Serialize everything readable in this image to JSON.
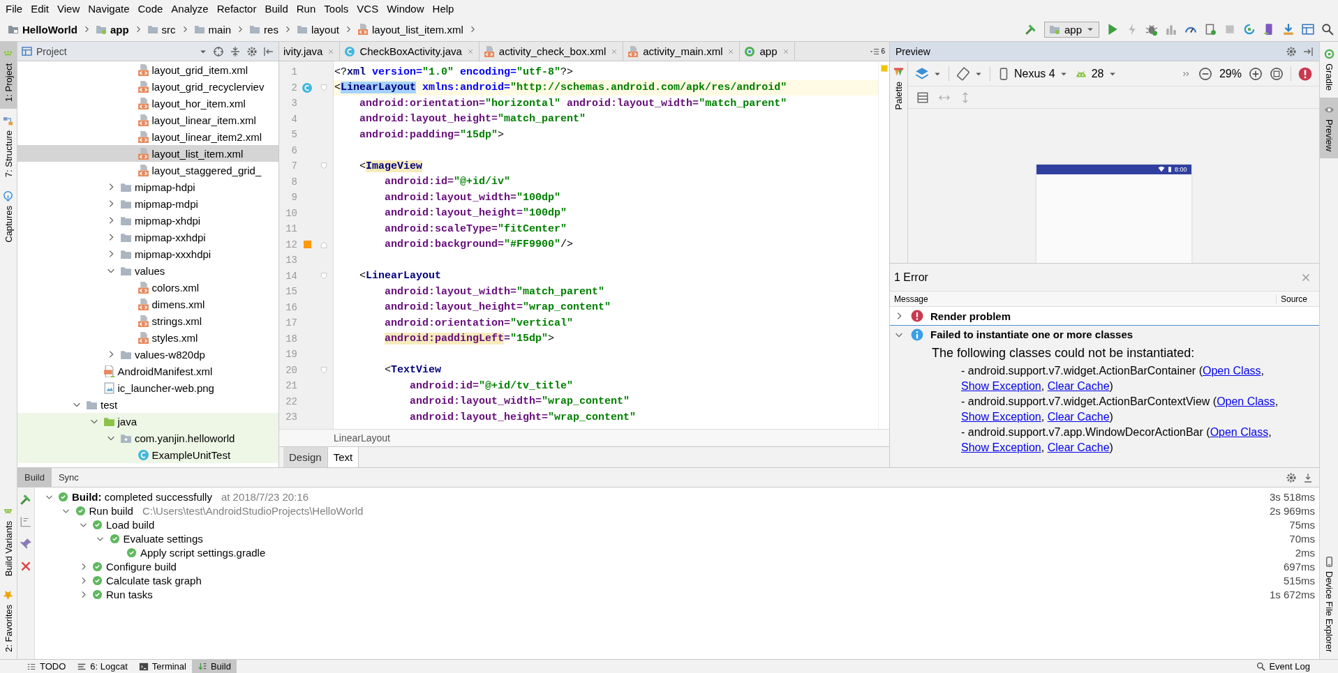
{
  "menu": [
    "File",
    "Edit",
    "View",
    "Navigate",
    "Code",
    "Analyze",
    "Refactor",
    "Build",
    "Run",
    "Tools",
    "VCS",
    "Window",
    "Help"
  ],
  "navbar": {
    "breadcrumbs": [
      {
        "label": "HelloWorld",
        "kind": "project"
      },
      {
        "label": "app",
        "kind": "module"
      },
      {
        "label": "src",
        "kind": "folder"
      },
      {
        "label": "main",
        "kind": "folder"
      },
      {
        "label": "res",
        "kind": "folder"
      },
      {
        "label": "layout",
        "kind": "folder"
      },
      {
        "label": "layout_list_item.xml",
        "kind": "xml"
      }
    ],
    "run_config": "app"
  },
  "tool_strips": {
    "left_top": [
      {
        "label": "1: Project",
        "kind": "android",
        "selected": true
      },
      {
        "label": "7: Structure",
        "kind": "structure",
        "selected": false
      },
      {
        "label": "Captures",
        "kind": "captures",
        "selected": false
      }
    ],
    "left_bottom": [
      {
        "label": "Build Variants",
        "kind": "android",
        "selected": false
      },
      {
        "label": "2: Favorites",
        "kind": "star",
        "selected": false
      }
    ],
    "right_top": [
      {
        "label": "Gradle",
        "kind": "gradle",
        "selected": false
      },
      {
        "label": "Preview",
        "kind": "eye",
        "selected": true
      }
    ],
    "right_bottom": [
      {
        "label": "Device File Explorer",
        "kind": "device",
        "selected": false
      }
    ]
  },
  "project_panel": {
    "title": "Project",
    "tree": [
      {
        "children": [
          {
            "children": [
              {
                "children": [
                  {
                    "label": "layout_grid_item.xml",
                    "kind": "xml",
                    "selected": false
                  },
                  {
                    "label": "layout_grid_recyclerviev",
                    "kind": "xml",
                    "selected": false
                  },
                  {
                    "label": "layout_hor_item.xml",
                    "kind": "xml",
                    "selected": false
                  },
                  {
                    "label": "layout_linear_item.xml",
                    "kind": "xml",
                    "selected": false
                  },
                  {
                    "label": "layout_linear_item2.xml",
                    "kind": "xml",
                    "selected": false
                  },
                  {
                    "label": "layout_list_item.xml",
                    "kind": "xml",
                    "selected": true
                  },
                  {
                    "label": "layout_staggered_grid_",
                    "kind": "xml",
                    "selected": false
                  }
                ]
              },
              {
                "label": "mipmap-hdpi",
                "kind": "folder",
                "selected": false,
                "expanded": false
              },
              {
                "label": "mipmap-mdpi",
                "kind": "folder",
                "selected": false,
                "expanded": false
              },
              {
                "label": "mipmap-xhdpi",
                "kind": "folder",
                "selected": false,
                "expanded": false
              },
              {
                "label": "mipmap-xxhdpi",
                "kind": "folder",
                "selected": false,
                "expanded": false
              },
              {
                "label": "mipmap-xxxhdpi",
                "kind": "folder",
                "selected": false,
                "expanded": false
              },
              {
                "label": "values",
                "kind": "folder",
                "selected": false,
                "expanded": true,
                "children": [
                  {
                    "label": "colors.xml",
                    "kind": "xml",
                    "selected": false
                  },
                  {
                    "label": "dimens.xml",
                    "kind": "xml",
                    "selected": false
                  },
                  {
                    "label": "strings.xml",
                    "kind": "xml",
                    "selected": false
                  },
                  {
                    "label": "styles.xml",
                    "kind": "xml",
                    "selected": false
                  }
                ]
              },
              {
                "label": "values-w820dp",
                "kind": "folder",
                "selected": false,
                "expanded": false
              }
            ]
          },
          {
            "label": "AndroidManifest.xml",
            "kind": "manifest",
            "selected": false
          },
          {
            "label": "ic_launcher-web.png",
            "kind": "image",
            "selected": false
          }
        ]
      },
      {
        "label": "test",
        "kind": "folder",
        "selected": false,
        "expanded": true,
        "children": [
          {
            "label": "java",
            "kind": "test-root",
            "selected": false,
            "expanded": true,
            "children": [
              {
                "label": "com.yanjin.helloworld",
                "kind": "package",
                "selected": false,
                "expanded": true,
                "children": [
                  {
                    "label": "ExampleUnitTest",
                    "kind": "class",
                    "selected": false
                  }
                ]
              }
            ]
          }
        ]
      }
    ]
  },
  "editor": {
    "tabs": [
      {
        "label": "ivity.java",
        "kind": "cut",
        "selected": false
      },
      {
        "label": "CheckBoxActivity.java",
        "kind": "class",
        "selected": false
      },
      {
        "label": "activity_check_box.xml",
        "kind": "xml",
        "selected": false
      },
      {
        "label": "activity_main.xml",
        "kind": "xml",
        "selected": false
      },
      {
        "label": "app",
        "kind": "run",
        "selected": false
      }
    ],
    "hidden_tab_count": "6",
    "lines": [
      {
        "number": "1",
        "current": false,
        "tokens": [
          {
            "kind": "punct",
            "text": "<?"
          },
          {
            "kind": "tag",
            "text": "xml"
          },
          {
            "kind": "ns",
            "text": " version="
          },
          {
            "kind": "value",
            "text": "\"1.0\""
          },
          {
            "kind": "ns",
            "text": " encoding="
          },
          {
            "kind": "value",
            "text": "\"utf-8\""
          },
          {
            "kind": "punct",
            "text": "?>"
          }
        ]
      },
      {
        "number": "2",
        "current": true,
        "class_marker": true,
        "fold_start": true,
        "tokens": [
          {
            "kind": "punct",
            "text": "<"
          },
          {
            "kind": "tag",
            "text": "LinearLayout",
            "selected": true
          },
          {
            "kind": "ns",
            "text": " xmlns:android="
          },
          {
            "kind": "value",
            "text": "\"http://schemas.android.com/apk/res/android\""
          }
        ]
      },
      {
        "number": "3",
        "current": false,
        "tokens": [
          {
            "kind": "attr",
            "text": "    android:orientation="
          },
          {
            "kind": "value",
            "text": "\"horizontal\""
          },
          {
            "kind": "attr",
            "text": " android:layout_width="
          },
          {
            "kind": "value",
            "text": "\"match_parent\""
          }
        ]
      },
      {
        "number": "4",
        "current": false,
        "tokens": [
          {
            "kind": "attr",
            "text": "    android:layout_height="
          },
          {
            "kind": "value",
            "text": "\"match_parent\""
          }
        ]
      },
      {
        "number": "5",
        "current": false,
        "tokens": [
          {
            "kind": "attr",
            "text": "    android:padding="
          },
          {
            "kind": "value",
            "text": "\"15dp\""
          },
          {
            "kind": "punct",
            "text": ">"
          }
        ]
      },
      {
        "number": "6",
        "current": false
      },
      {
        "number": "7",
        "current": false,
        "fold_start": true,
        "tokens": [
          {
            "kind": "punct",
            "text": "    <"
          },
          {
            "kind": "tag",
            "text": "ImageView",
            "matched": true
          }
        ]
      },
      {
        "number": "8",
        "current": false,
        "tokens": [
          {
            "kind": "attr",
            "text": "        android:id="
          },
          {
            "kind": "value",
            "text": "\"@+id/iv\""
          }
        ]
      },
      {
        "number": "9",
        "current": false,
        "tokens": [
          {
            "kind": "attr",
            "text": "        android:layout_width="
          },
          {
            "kind": "value",
            "text": "\"100dp\""
          }
        ]
      },
      {
        "number": "10",
        "current": false,
        "tokens": [
          {
            "kind": "attr",
            "text": "        android:layout_height="
          },
          {
            "kind": "value",
            "text": "\"100dp\""
          }
        ]
      },
      {
        "number": "11",
        "current": false,
        "tokens": [
          {
            "kind": "attr",
            "text": "        android:scaleType="
          },
          {
            "kind": "value",
            "text": "\"fitCenter\""
          }
        ]
      },
      {
        "number": "12",
        "current": false,
        "color": "#ff9900",
        "fold_end": true,
        "tokens": [
          {
            "kind": "attr",
            "text": "        android:background="
          },
          {
            "kind": "value",
            "text": "\"#FF9900\""
          },
          {
            "kind": "punct",
            "text": "/>"
          }
        ]
      },
      {
        "number": "13",
        "current": false
      },
      {
        "number": "14",
        "current": false,
        "fold_start": true,
        "tokens": [
          {
            "kind": "punct",
            "text": "    <"
          },
          {
            "kind": "tag",
            "text": "LinearLayout"
          }
        ]
      },
      {
        "number": "15",
        "current": false,
        "tokens": [
          {
            "kind": "attr",
            "text": "        android:layout_width="
          },
          {
            "kind": "value",
            "text": "\"match_parent\""
          }
        ]
      },
      {
        "number": "16",
        "current": false,
        "tokens": [
          {
            "kind": "attr",
            "text": "        android:layout_height="
          },
          {
            "kind": "value",
            "text": "\"wrap_content\""
          }
        ]
      },
      {
        "number": "17",
        "current": false,
        "tokens": [
          {
            "kind": "attr",
            "text": "        android:orientation="
          },
          {
            "kind": "value",
            "text": "\"vertical\""
          }
        ]
      },
      {
        "number": "18",
        "current": false,
        "tokens": [
          {
            "kind": "attr",
            "text": "        android:paddingLeft",
            "matched": true
          },
          {
            "kind": "attr",
            "text": "="
          },
          {
            "kind": "value",
            "text": "\"15dp\""
          },
          {
            "kind": "punct",
            "text": ">"
          }
        ]
      },
      {
        "number": "19",
        "current": false
      },
      {
        "number": "20",
        "current": false,
        "fold_start": true,
        "tokens": [
          {
            "kind": "punct",
            "text": "        <"
          },
          {
            "kind": "tag",
            "text": "TextView"
          }
        ]
      },
      {
        "number": "21",
        "current": false,
        "tokens": [
          {
            "kind": "attr",
            "text": "            android:id="
          },
          {
            "kind": "value",
            "text": "\"@+id/tv_title\""
          }
        ]
      },
      {
        "number": "22",
        "current": false,
        "tokens": [
          {
            "kind": "attr",
            "text": "            android:layout_width="
          },
          {
            "kind": "value",
            "text": "\"wrap_content\""
          }
        ]
      },
      {
        "number": "23",
        "current": false,
        "tokens": [
          {
            "kind": "attr",
            "text": "            android:layout_height="
          },
          {
            "kind": "value",
            "text": "\"wrap_content\""
          }
        ]
      }
    ],
    "breadcrumb": "LinearLayout",
    "mode_tabs": [
      {
        "label": "Design",
        "selected": false
      },
      {
        "label": "Text",
        "selected": true
      }
    ]
  },
  "preview": {
    "title": "Preview",
    "palette_label": "Palette",
    "device": "Nexus 4",
    "api_level": "28",
    "zoom": "29%",
    "status_time": "8:00",
    "errors": {
      "title": "1 Error",
      "columns": [
        "Message",
        "Source"
      ],
      "items": [
        {
          "kind": "error",
          "title": "Render problem",
          "expanded": false,
          "selected": false
        },
        {
          "kind": "info",
          "title": "Failed to instantiate one or more classes",
          "expanded": true,
          "selected": true,
          "intro": "The following classes could not be instantiated:",
          "entries": [
            [
              {
                "text": "- android.support.v7.widget.ActionBarContainer ("
              },
              {
                "link": "Open Class"
              },
              {
                "text": ", "
              },
              {
                "link": "Show Exception"
              },
              {
                "text": ", "
              },
              {
                "link": "Clear Cache"
              },
              {
                "text": ")"
              }
            ],
            [
              {
                "text": "- android.support.v7.widget.ActionBarContextView ("
              },
              {
                "link": "Open Class"
              },
              {
                "text": ", "
              },
              {
                "link": "Show Exception"
              },
              {
                "text": ", "
              },
              {
                "link": "Clear Cache"
              },
              {
                "text": ")"
              }
            ],
            [
              {
                "text": "- android.support.v7.app.WindowDecorActionBar ("
              },
              {
                "link": "Open Class"
              },
              {
                "text": ", "
              },
              {
                "link": "Show Exception"
              },
              {
                "text": ", "
              },
              {
                "link": "Clear Cache"
              },
              {
                "text": ")"
              }
            ]
          ]
        }
      ]
    }
  },
  "build": {
    "tabs": [
      {
        "label": "Build",
        "selected": true
      },
      {
        "label": "Sync",
        "selected": false
      }
    ],
    "tree": [
      {
        "label": "**Build:** completed successfully",
        "note": "at 2018/7/23 20:16",
        "duration": "3s 518ms",
        "succeeded": true,
        "expanded": true,
        "children": [
          {
            "label": "Run build",
            "note": "C:\\Users\\test\\AndroidStudioProjects\\HelloWorld",
            "duration": "2s 969ms",
            "succeeded": true,
            "expanded": true,
            "children": [
              {
                "label": "Load build",
                "duration": "75ms",
                "succeeded": true,
                "expanded": true,
                "children": [
                  {
                    "label": "Evaluate settings",
                    "duration": "70ms",
                    "succeeded": true,
                    "expanded": true,
                    "children": [
                      {
                        "label": "Apply script settings.gradle",
                        "duration": "2ms",
                        "succeeded": true
                      }
                    ]
                  }
                ]
              },
              {
                "label": "Configure build",
                "duration": "697ms",
                "succeeded": true,
                "expanded": false
              },
              {
                "label": "Calculate task graph",
                "duration": "515ms",
                "succeeded": true,
                "expanded": false
              },
              {
                "label": "Run tasks",
                "duration": "1s 672ms",
                "succeeded": true,
                "expanded": false
              }
            ]
          }
        ]
      }
    ]
  },
  "status_bar": {
    "tabs": [
      {
        "label": "TODO",
        "kind": "todo",
        "selected": false
      },
      {
        "label": "6: Logcat",
        "kind": "logcat",
        "selected": false
      },
      {
        "label": "Terminal",
        "kind": "terminal",
        "selected": false
      },
      {
        "label": "Build",
        "kind": "build",
        "selected": true
      }
    ],
    "event_log": "Event Log"
  }
}
